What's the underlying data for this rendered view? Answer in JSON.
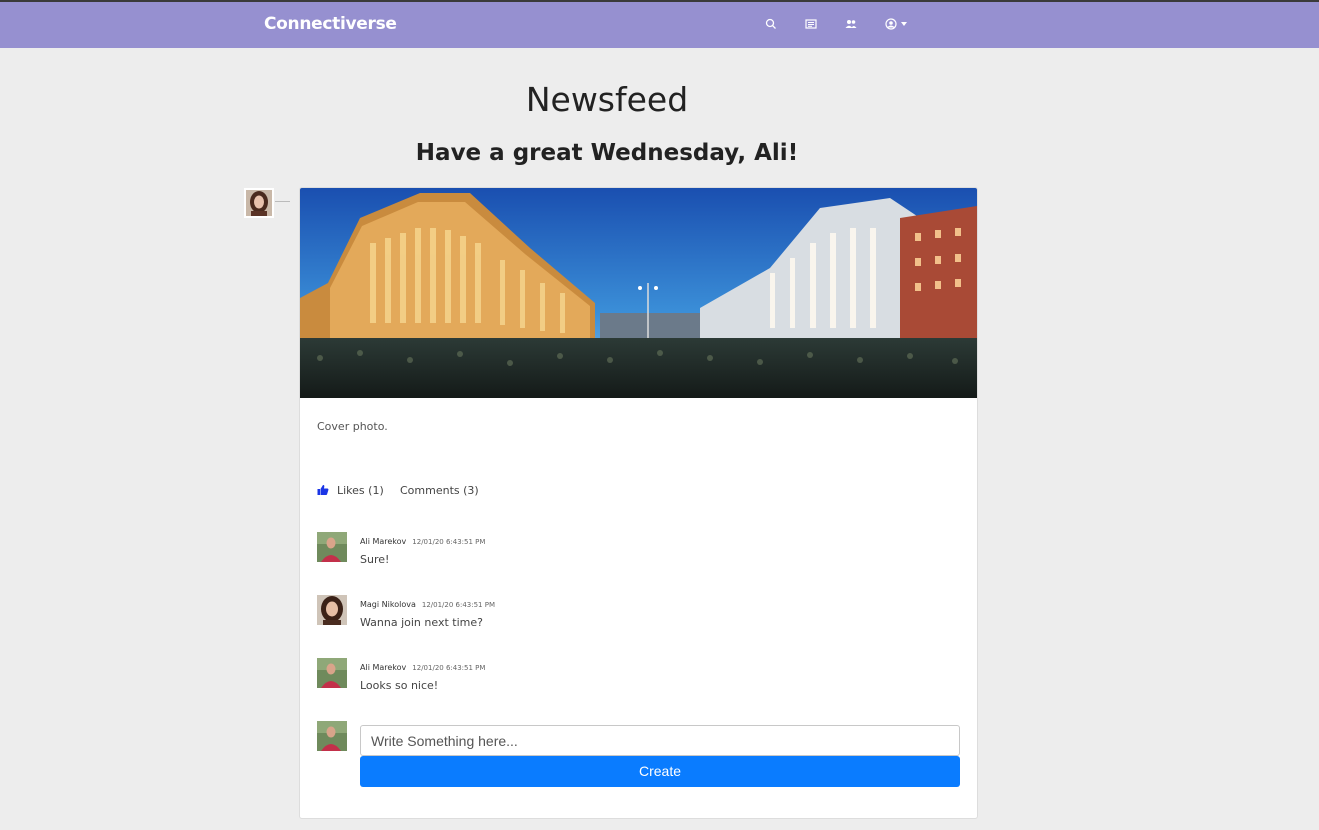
{
  "app": {
    "brand": "Connectiverse"
  },
  "nav": {
    "icons": [
      "search-icon",
      "newspaper-icon",
      "users-icon",
      "user-circle-icon",
      "caret-down-icon"
    ]
  },
  "colors": {
    "navbar": "#9690d0",
    "page_bg": "#ededed",
    "primary": "#0a7cff",
    "like_icon": "#1a35e6"
  },
  "page": {
    "title": "Newsfeed",
    "greeting": "Have a great Wednesday, Ali!"
  },
  "post": {
    "caption": "Cover photo.",
    "likes_label": "Likes (1)",
    "comments_label": "Comments (3)",
    "comments": [
      {
        "author": "Ali Marekov",
        "time": "12/01/20 6:43:51 PM",
        "text": "Sure!"
      },
      {
        "author": "Magi Nikolova",
        "time": "12/01/20 6:43:51 PM",
        "text": "Wanna join next time?"
      },
      {
        "author": "Ali Marekov",
        "time": "12/01/20 6:43:51 PM",
        "text": "Looks so nice!"
      }
    ],
    "composer": {
      "placeholder": "Write Something here...",
      "create_label": "Create"
    }
  }
}
